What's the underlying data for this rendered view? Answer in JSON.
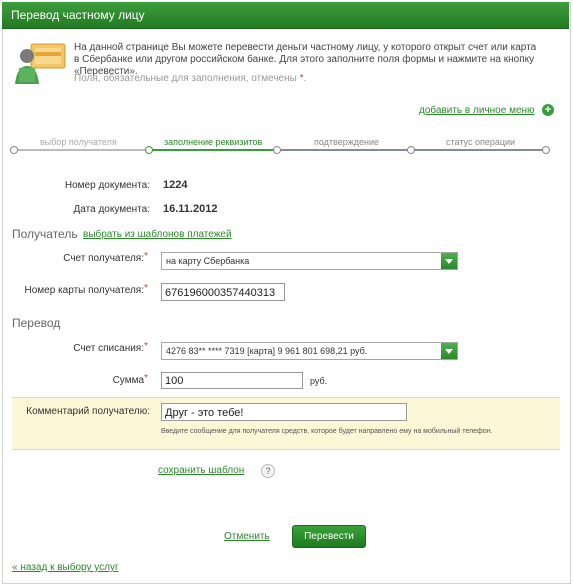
{
  "header": {
    "title": "Перевод частному лицу"
  },
  "intro": {
    "text": "На данной странице Вы можете перевести деньги частному лицу, у которого открыт счет или карта в Сбербанке или другом российском банке. Для этого заполните поля формы и нажмите на кнопку «Перевести».",
    "required_note": "Поля, обязательные для заполнения, отмечены",
    "required_mark": "*"
  },
  "add_menu": {
    "label": "добавить в личное меню",
    "icon": "plus-icon"
  },
  "steps": [
    {
      "label": "выбор получателя",
      "state": "done"
    },
    {
      "label": "заполнение реквизитов",
      "state": "active"
    },
    {
      "label": "подтверждение",
      "state": "pending"
    },
    {
      "label": "статус операции",
      "state": "pending"
    }
  ],
  "document": {
    "number_label": "Номер документа:",
    "number_value": "1224",
    "date_label": "Дата документа:",
    "date_value": "16.11.2012"
  },
  "recipient": {
    "section_title": "Получатель",
    "templates_link": "выбрать из шаблонов платежей",
    "account_label": "Счет получателя:",
    "account_value": "на карту Сбербанка",
    "card_label": "Номер карты получателя:",
    "card_value": "676196000357440313"
  },
  "transfer": {
    "section_title": "Перевод",
    "debit_label": "Счет списания:",
    "debit_value": "4276 83** **** 7319  [карта] 9 961 801 698,21  руб.",
    "amount_label": "Сумма",
    "amount_value": "100",
    "currency": "руб.",
    "comment_label": "Комментарий получателю:",
    "comment_value": "Друг - это тебе!",
    "comment_hint": "Введите сообщение для получателя средств, которое будет направлено ему на мобильный телефон."
  },
  "save_template": {
    "label": "сохранить шаблон",
    "help": "?"
  },
  "actions": {
    "cancel": "Отменить",
    "submit": "Перевести"
  },
  "back_link": "« назад к выбору услуг",
  "required_mark": "*",
  "colors": {
    "accent": "#2a8a2a",
    "header": "#2e8b2e",
    "required": "#e03030",
    "highlight": "#fcf7d6"
  }
}
